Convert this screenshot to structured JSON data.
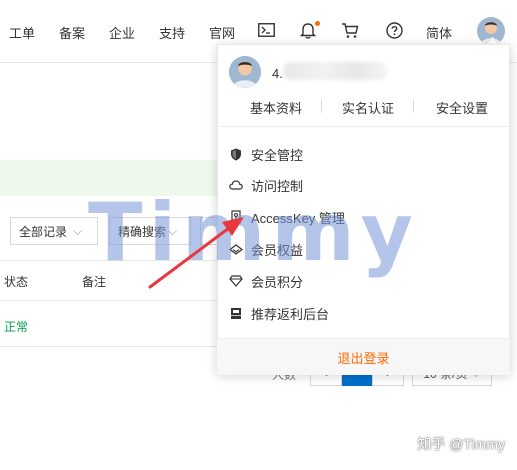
{
  "topnav": {
    "items": [
      "工单",
      "备案",
      "企业",
      "支持",
      "官网"
    ],
    "lang_label": "简体"
  },
  "icons": {
    "terminal": "terminal-icon",
    "bell": "bell-icon",
    "cart": "cart-icon",
    "help": "help-icon",
    "notification_dot_color": "#ff6a00"
  },
  "user_panel": {
    "account_name": "4.",
    "links": [
      "基本资料",
      "实名认证",
      "安全设置"
    ],
    "menu": [
      {
        "label": "安全管控",
        "icon": "shield-icon"
      },
      {
        "label": "访问控制",
        "icon": "cloud-icon"
      },
      {
        "label": "AccessKey 管理",
        "icon": "key-icon"
      },
      {
        "label": "会员权益",
        "icon": "diamond-icon"
      },
      {
        "label": "会员积分",
        "icon": "gem-icon"
      },
      {
        "label": "推荐返利后台",
        "icon": "inbox-icon"
      }
    ],
    "logout_label": "退出登录",
    "logout_color": "#ff6a00"
  },
  "background_page": {
    "filter_all": "全部记录",
    "filter_search": "精确搜索",
    "columns": [
      "状态",
      "备注"
    ],
    "row_status": "正常",
    "row_status_color": "#00a04a",
    "pager_per_page_fragment": "人数",
    "pager_size": "10 条/页"
  },
  "overlays": {
    "watermark_text": "Timmy",
    "zhihu_credit": "知乎 @Timmy",
    "arrow_color": "#e8383d"
  }
}
